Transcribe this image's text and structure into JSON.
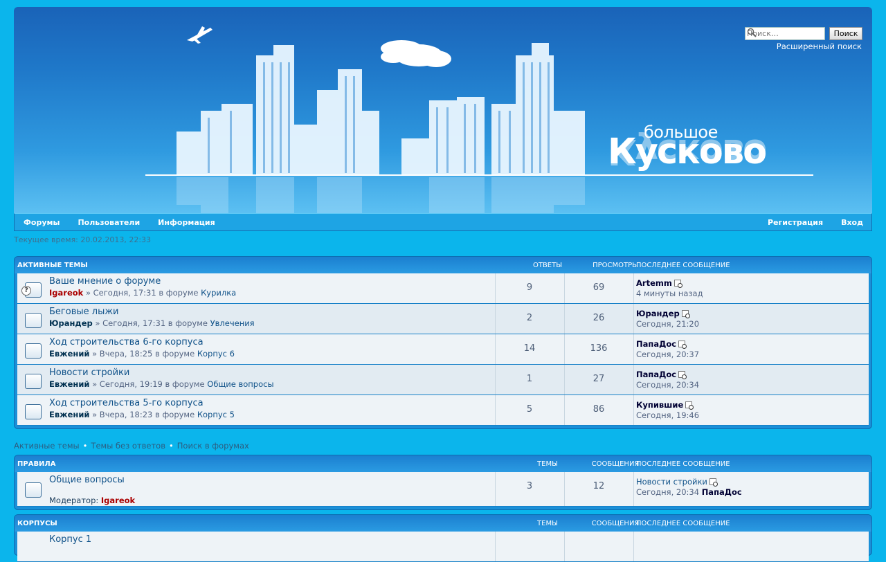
{
  "header": {
    "search_placeholder": "Поиск…",
    "search_button": "Поиск",
    "advanced_search": "Расширенный поиск",
    "logo_top": "большое",
    "logo_main": "Кусково"
  },
  "nav": {
    "forums": "Форумы",
    "users": "Пользователи",
    "info": "Информация",
    "register": "Регистрация",
    "login": "Вход"
  },
  "current_time": "Текущее время: 20.02.2013, 22:33",
  "active_topics": {
    "title": "АКТИВНЫЕ ТЕМЫ",
    "col_replies": "ОТВЕТЫ",
    "col_views": "ПРОСМОТРЫ",
    "col_last": "ПОСЛЕДНЕЕ СООБЩЕНИЕ",
    "rows": [
      {
        "title": "Ваше мнение о форуме",
        "author": "Igareok",
        "date": "» Сегодня, 17:31 в форуме",
        "forum": "Курилка",
        "replies": "9",
        "views": "69",
        "last_user": "Artemm",
        "last_time": "4 минуты назад"
      },
      {
        "title": "Беговые лыжи",
        "author": "Юрандер",
        "date": "» Сегодня, 17:31 в форуме",
        "forum": "Увлечения",
        "replies": "2",
        "views": "26",
        "last_user": "Юрандер",
        "last_time": "Сегодня, 21:20"
      },
      {
        "title": "Ход строительства 6-го корпуса",
        "author": "Евжений",
        "date": "» Вчера, 18:25 в форуме",
        "forum": "Корпус 6",
        "replies": "14",
        "views": "136",
        "last_user": "ПапаДос",
        "last_time": "Сегодня, 20:37"
      },
      {
        "title": "Новости стройки",
        "author": "Евжений",
        "date": "» Сегодня, 19:19 в форуме",
        "forum": "Общие вопросы",
        "replies": "1",
        "views": "27",
        "last_user": "ПапаДос",
        "last_time": "Сегодня, 20:34"
      },
      {
        "title": "Ход строительства 5-го корпуса",
        "author": "Евжений",
        "date": "» Вчера, 18:23 в форуме",
        "forum": "Корпус 5",
        "replies": "5",
        "views": "86",
        "last_user": "Купившие",
        "last_time": "Сегодня, 19:46"
      }
    ]
  },
  "links": {
    "active": "Активные темы",
    "unanswered": "Темы без ответов",
    "search": "Поиск в форумах",
    "separator": "•"
  },
  "rules": {
    "title": "ПРАВИЛА",
    "col_topics": "ТЕМЫ",
    "col_posts": "СООБЩЕНИЯ",
    "col_last": "ПОСЛЕДНЕЕ СООБЩЕНИЕ",
    "row": {
      "title": "Общие вопросы",
      "moderator_label": "Модератор:",
      "moderator": "Igareok",
      "topics": "3",
      "posts": "12",
      "last_topic": "Новости стройки",
      "last_time": "Сегодня, 20:34",
      "last_user": "ПапаДос"
    }
  },
  "buildings": {
    "title": "КОРПУСЫ",
    "col_topics": "ТЕМЫ",
    "col_posts": "СООБЩЕНИЯ",
    "col_last": "ПОСЛЕДНЕЕ СООБЩЕНИЕ",
    "first_row_title": "Корпус 1"
  },
  "colors": {
    "background": "#0bb5ec",
    "header_blue": "#1a63b8",
    "link": "#105289",
    "moderator": "#aa0000"
  }
}
